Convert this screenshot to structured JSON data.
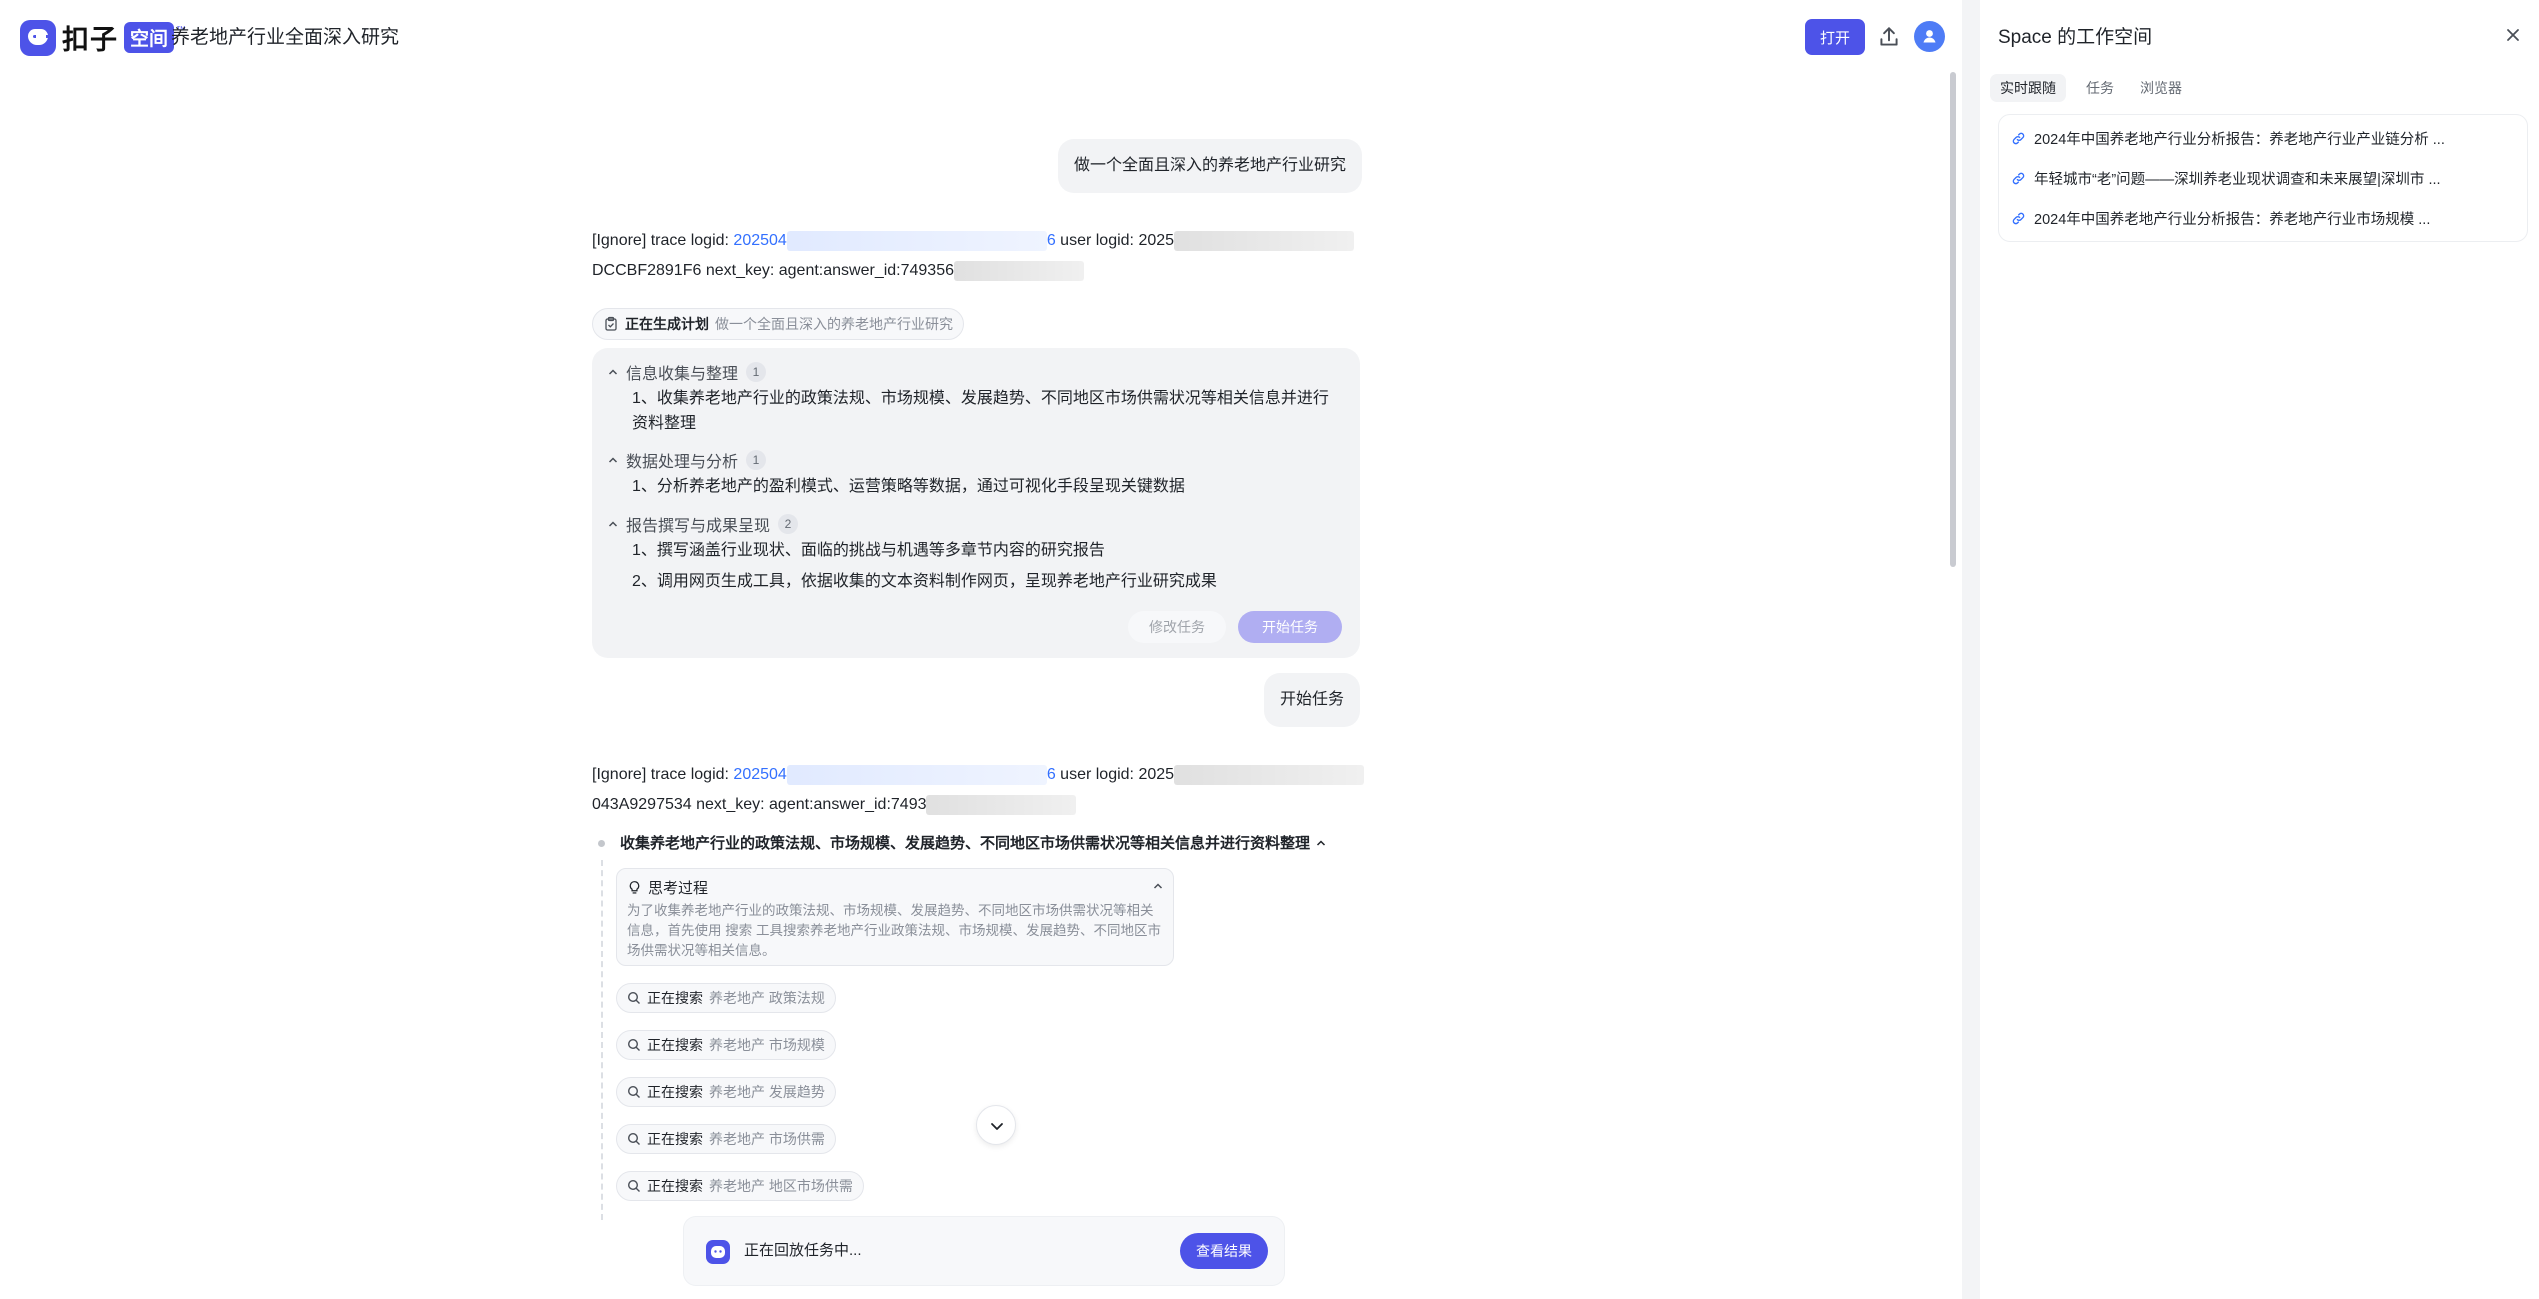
{
  "app": {
    "logo_text": "扣子",
    "logo_badge": "空间",
    "logo_tm": "™",
    "page_title": "养老地产行业全面深入研究",
    "open_button": "打开"
  },
  "chat": {
    "user_message_1": "做一个全面且深入的养老地产行业研究",
    "trace_1": {
      "prefix": "[Ignore] trace logid: ",
      "logid_start": "202504",
      "logid_end": "6",
      "user_logid_label": " user logid: ",
      "user_logid_start": "2025",
      "line2_start": "DCCBF2891F6 next_key: agent:answer_id:749356"
    },
    "plan_chip": {
      "label": "正在生成计划",
      "subject": "做一个全面且深入的养老地产行业研究"
    },
    "plan": {
      "sections": [
        {
          "title": "信息收集与整理",
          "count": "1",
          "steps": [
            "1、收集养老地产行业的政策法规、市场规模、发展趋势、不同地区市场供需状况等相关信息并进行资料整理"
          ]
        },
        {
          "title": "数据处理与分析",
          "count": "1",
          "steps": [
            "1、分析养老地产的盈利模式、运营策略等数据，通过可视化手段呈现关键数据"
          ]
        },
        {
          "title": "报告撰写与成果呈现",
          "count": "2",
          "steps": [
            "1、撰写涵盖行业现状、面临的挑战与机遇等多章节内容的研究报告",
            "2、调用网页生成工具，依据收集的文本资料制作网页，呈现养老地产行业研究成果"
          ]
        }
      ],
      "modify_button": "修改任务",
      "start_button": "开始任务"
    },
    "user_message_2": "开始任务",
    "trace_2": {
      "prefix": "[Ignore] trace logid: ",
      "logid_start": "202504",
      "logid_end": "6",
      "user_logid_label": " user logid: ",
      "user_logid_start": "2025",
      "line2_start": "043A9297534 next_key: agent:answer_id:7493"
    },
    "task_step": {
      "title": "收集养老地产行业的政策法规、市场规模、发展趋势、不同地区市场供需状况等相关信息并进行资料整理",
      "think_title": "思考过程",
      "think_text": "为了收集养老地产行业的政策法规、市场规模、发展趋势、不同地区市场供需状况等相关信息，首先使用 搜索 工具搜索养老地产行业政策法规、市场规模、发展趋势、不同地区市场供需状况等相关信息。",
      "searches": [
        {
          "label": "正在搜索",
          "query": "养老地产 政策法规"
        },
        {
          "label": "正在搜索",
          "query": "养老地产 市场规模"
        },
        {
          "label": "正在搜索",
          "query": "养老地产 发展趋势"
        },
        {
          "label": "正在搜索",
          "query": "养老地产 市场供需"
        },
        {
          "label": "正在搜索",
          "query": "养老地产 地区市场供需"
        }
      ]
    },
    "replay": {
      "text": "正在回放任务中...",
      "button": "查看结果"
    }
  },
  "panel": {
    "title": "Space 的工作空间",
    "tabs": [
      "实时跟随",
      "任务",
      "浏览器"
    ],
    "active_tab": "实时跟随",
    "links": [
      "2024年中国养老地产行业分析报告：养老地产行业产业链分析 ...",
      "年轻城市“老”问题——深圳养老业现状调查和未来展望|深圳市 ...",
      "2024年中国养老地产行业分析报告：养老地产行业市场规模 ..."
    ]
  },
  "colors": {
    "accent": "#4d53e8",
    "link": "#3370ff",
    "bubble": "#f2f3f5"
  }
}
